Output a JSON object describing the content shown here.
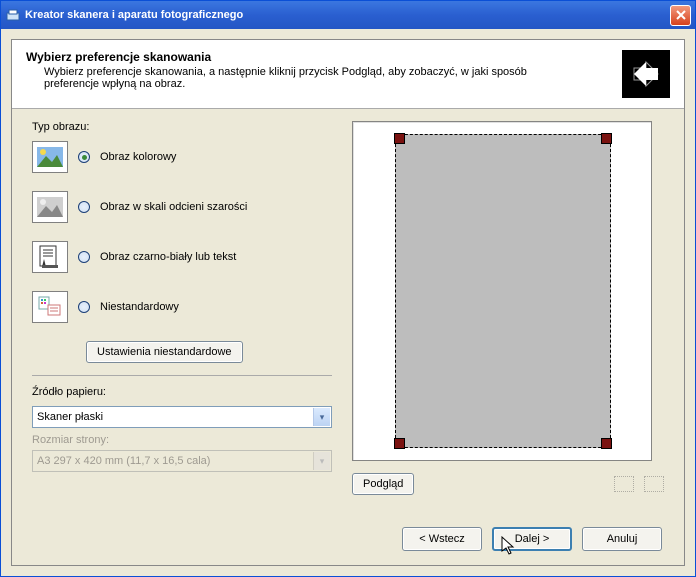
{
  "window": {
    "title": "Kreator skanera i aparatu fotograficznego"
  },
  "header": {
    "title": "Wybierz preferencje skanowania",
    "subtitle": "Wybierz preferencje skanowania, a następnie kliknij przycisk Podgląd, aby zobaczyć, w jaki sposób preferencje wpłyną na obraz."
  },
  "labels": {
    "image_type": "Typ obrazu:",
    "paper_source": "Źródło papieru:",
    "page_size": "Rozmiar strony:"
  },
  "options": {
    "color": "Obraz kolorowy",
    "gray": "Obraz w skali odcieni szarości",
    "bw": "Obraz czarno-biały lub tekst",
    "custom": "Niestandardowy"
  },
  "buttons": {
    "custom_settings": "Ustawienia niestandardowe",
    "preview": "Podgląd",
    "back": "< Wstecz",
    "next": "Dalej >",
    "cancel": "Anuluj"
  },
  "combos": {
    "paper_source_value": "Skaner płaski",
    "page_size_value": "A3 297 x 420 mm (11,7 x 16,5 cala)"
  }
}
